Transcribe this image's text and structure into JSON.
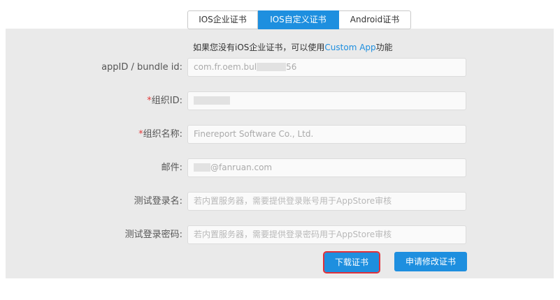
{
  "tabs": [
    {
      "label": "IOS企业证书",
      "active": false
    },
    {
      "label": "IOS自定义证书",
      "active": true
    },
    {
      "label": "Android证书",
      "active": false
    }
  ],
  "hint": {
    "prefix": "如果您没有iOS企业证书，可以使用",
    "link": "Custom App",
    "suffix": "功能"
  },
  "form": {
    "appid": {
      "label": "appID / bundle id:",
      "value_prefix": "com.fr.oem.bul",
      "value_suffix": "56"
    },
    "orgid": {
      "label": "组织ID:",
      "required_mark": "*"
    },
    "orgname": {
      "label": "组织名称:",
      "required_mark": "*",
      "value": "Finereport Software Co., Ltd."
    },
    "email": {
      "label": "邮件:",
      "value_suffix": "@fanruan.com"
    },
    "test_user": {
      "label": "测试登录名:",
      "placeholder": "若内置服务器，需要提供登录账号用于AppStore审核"
    },
    "test_password": {
      "label": "测试登录密码:",
      "placeholder": "若内置服务器，需要提供登录密码用于AppStore审核"
    }
  },
  "buttons": {
    "download": "下载证书",
    "apply": "申请修改证书"
  },
  "colors": {
    "accent": "#1e8fdf",
    "required": "#e23b3b",
    "highlight": "#e0303a",
    "panel": "#eaeaea"
  }
}
